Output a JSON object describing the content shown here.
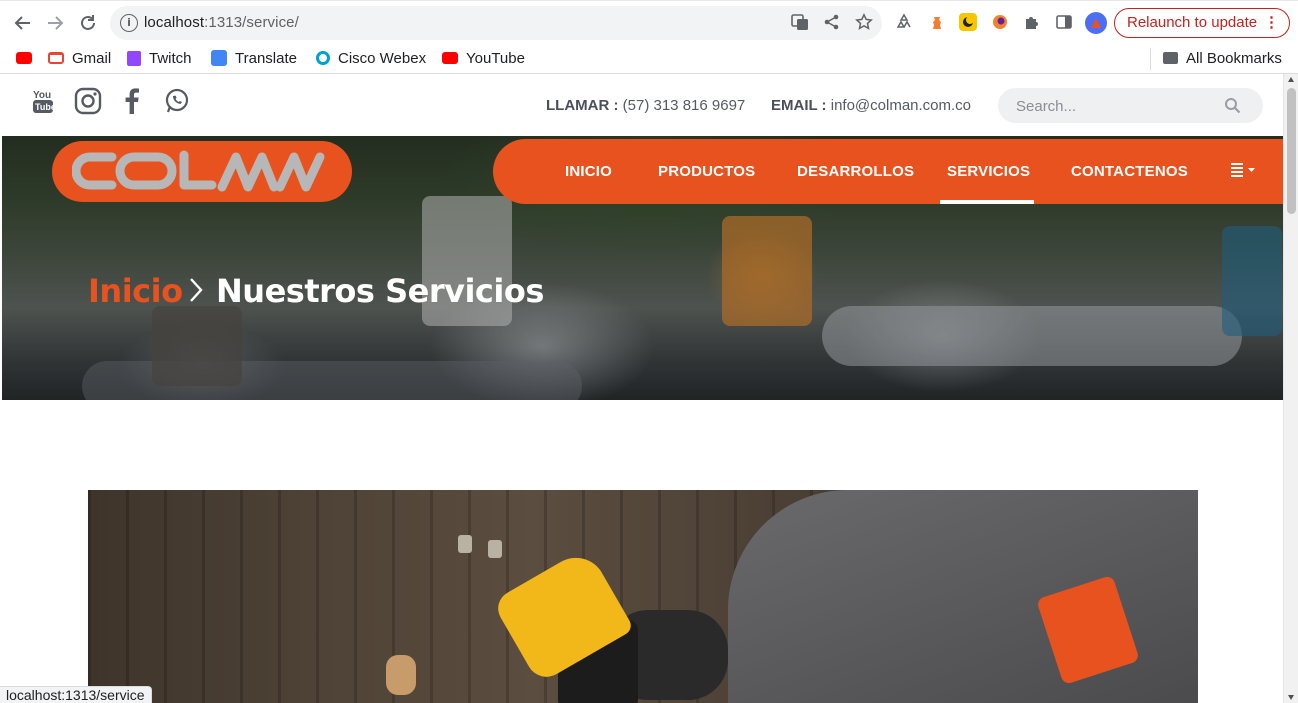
{
  "browser": {
    "url_host": "localhost",
    "url_path": ":1313/service/",
    "relaunch_label": "Relaunch to update",
    "status_url": "localhost:1313/service"
  },
  "bookmarks": [
    {
      "label": "",
      "icon": "youtube-icon",
      "color": "#ff0000"
    },
    {
      "label": "Gmail",
      "icon": "gmail-icon",
      "color": "#ea4335"
    },
    {
      "label": "Twitch",
      "icon": "twitch-icon",
      "color": "#9146ff"
    },
    {
      "label": "Translate",
      "icon": "translate-icon",
      "color": "#4285f4"
    },
    {
      "label": "Cisco Webex",
      "icon": "webex-icon",
      "color": "#00a0d1"
    },
    {
      "label": "YouTube",
      "icon": "youtube-icon",
      "color": "#ff0000"
    }
  ],
  "all_bookmarks_label": "All Bookmarks",
  "site": {
    "contact": {
      "phone_label": "LLAMAR :",
      "phone": "(57) 313 816 9697",
      "email_label": "EMAIL :",
      "email": "info@colman.com.co"
    },
    "search_placeholder": "Search...",
    "logo_text": "COLMAN",
    "menu": [
      "INICIO",
      "PRODUCTOS",
      "DESARROLLOS",
      "SERVICIOS",
      "CONTACTENOS"
    ],
    "active_menu": "SERVICIOS",
    "breadcrumb": {
      "home": "Inicio",
      "current": "Nuestros Servicios"
    },
    "colors": {
      "brand_orange": "#e8521f",
      "text_gray": "#555a64"
    }
  }
}
